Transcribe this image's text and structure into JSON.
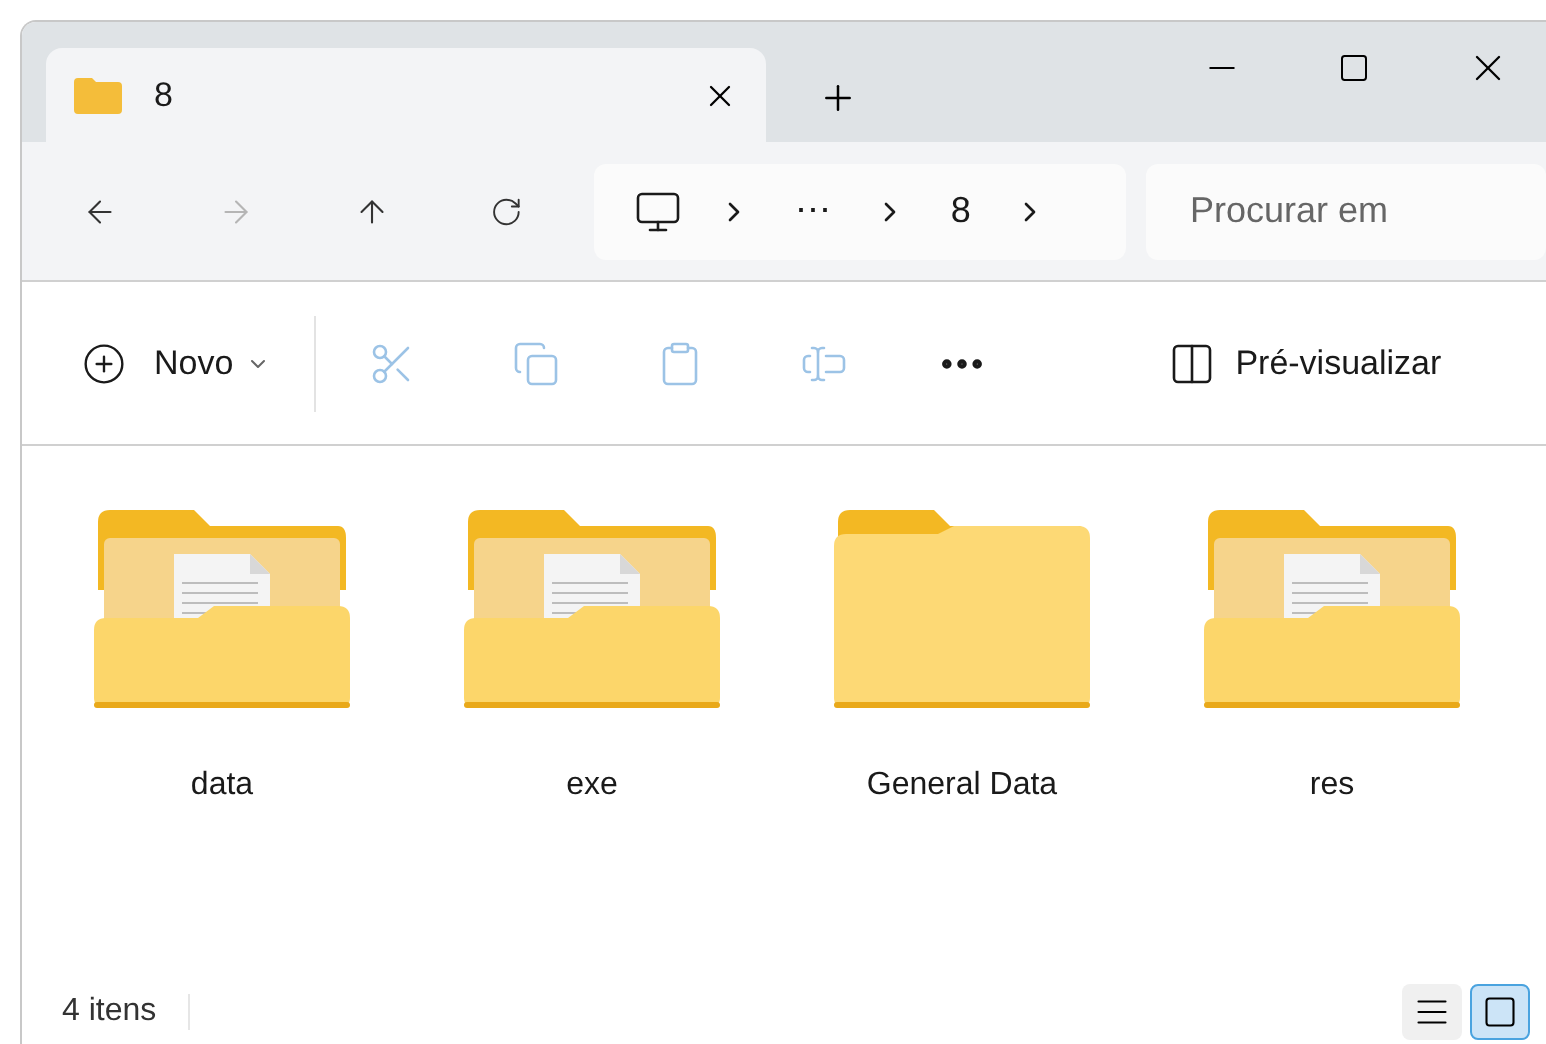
{
  "tab": {
    "title": "8",
    "selected": true
  },
  "address": {
    "crumbs": [
      "⋯",
      "8"
    ]
  },
  "search": {
    "placeholder": "Procurar em"
  },
  "toolbar": {
    "new_label": "Novo",
    "preview_label": "Pré-visualizar",
    "actions": [
      {
        "kind": "cut",
        "disabled": true
      },
      {
        "kind": "copy",
        "disabled": true
      },
      {
        "kind": "paste",
        "disabled": true
      },
      {
        "kind": "rename",
        "disabled": true
      }
    ]
  },
  "items": [
    {
      "name": "data",
      "kind": "folder_with_files"
    },
    {
      "name": "exe",
      "kind": "folder_with_files"
    },
    {
      "name": "General Data",
      "kind": "folder"
    },
    {
      "name": "res",
      "kind": "folder_with_files"
    }
  ],
  "status_bar": {
    "count": "4 itens",
    "views": [
      {
        "kind": "details",
        "selected": false
      },
      {
        "kind": "tiles",
        "selected": true
      }
    ]
  }
}
